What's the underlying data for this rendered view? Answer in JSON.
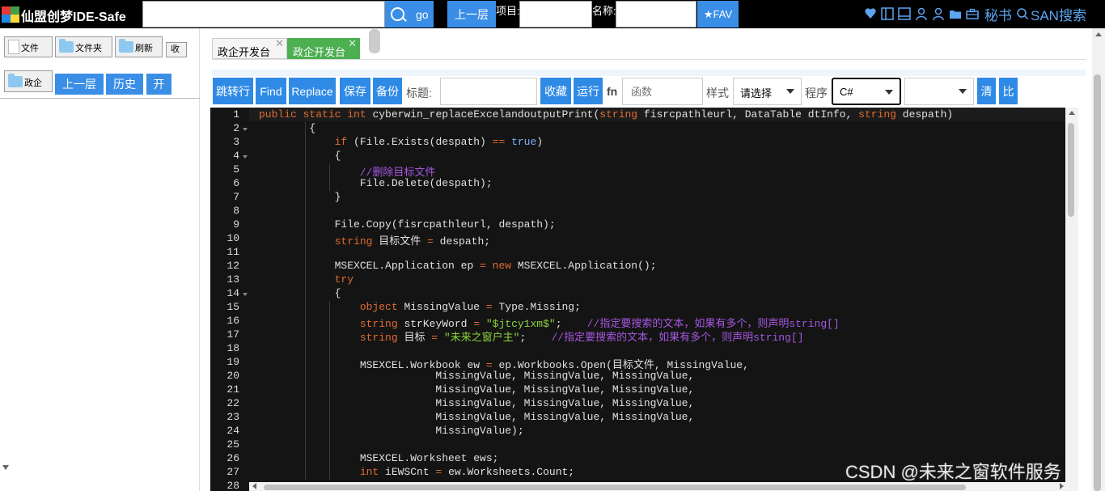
{
  "topbar": {
    "app_title": "仙盟创梦IDE-Safe",
    "search_value": "",
    "go_label": "go",
    "up_label": "上一层",
    "project_label": "项目:",
    "project_value": "",
    "name_label": "名称:",
    "name_value": "",
    "fav_label": "★FAV",
    "secretary_label": "秘书",
    "san_search_label": "SAN搜索"
  },
  "left_panel": {
    "file_button": "文件",
    "folder_button": "文件夹",
    "refresh_button": "刷新",
    "collapse_button": "收",
    "current_folder": "政企",
    "up_button": "上一层",
    "history_button": "历史",
    "open_button": "开"
  },
  "tabs": [
    {
      "label": "政企开发台",
      "active": false
    },
    {
      "label": "政企开发台",
      "active": true
    }
  ],
  "tab_close_glyph": "✕",
  "toolbar": {
    "goto_line": "跳转行",
    "find": "Find",
    "replace": "Replace",
    "save": "保存",
    "backup": "备份",
    "title_label": "标题:",
    "title_value": "",
    "collect": "收藏",
    "run": "运行",
    "fn_label": "fn",
    "function_placeholder": "函数",
    "style_label": "样式",
    "style_select": "请选择",
    "program_label": "程序",
    "language_select": "C#",
    "extra_select": "",
    "clear": "清",
    "compare": "比"
  },
  "colors": {
    "accent_blue": "#2f8ae5",
    "editor_bg": "#141414",
    "keyword": "#e06c32",
    "comment": "#a657e0",
    "string": "#8bd73c",
    "bool": "#7ab0f5"
  },
  "editor": {
    "line_numbers": [
      "1",
      "2",
      "3",
      "4",
      "5",
      "6",
      "7",
      "8",
      "9",
      "10",
      "11",
      "12",
      "13",
      "14",
      "15",
      "16",
      "17",
      "18",
      "19",
      "20",
      "21",
      "22",
      "23",
      "24",
      "25",
      "26",
      "27",
      "28"
    ],
    "folded_lines": [
      2,
      4,
      14
    ],
    "lines": [
      [
        [
          "kw",
          "public static int "
        ],
        [
          "",
          "cyberwin_replaceExcelandoutputPrint("
        ],
        [
          "kw",
          "string "
        ],
        [
          "",
          "fisrcpathleurl, DataTable dtInfo, "
        ],
        [
          "kw",
          "string "
        ],
        [
          "",
          "despath)"
        ]
      ],
      [
        [
          "",
          "        {"
        ]
      ],
      [
        [
          "",
          "            "
        ],
        [
          "kw",
          "if "
        ],
        [
          "",
          "(File.Exists(despath) "
        ],
        [
          "op",
          "== "
        ],
        [
          "tr",
          "true"
        ],
        [
          "",
          ")"
        ]
      ],
      [
        [
          "",
          "            {"
        ]
      ],
      [
        [
          "",
          "                "
        ],
        [
          "cm",
          "//删除目标文件"
        ]
      ],
      [
        [
          "",
          "                File.Delete(despath);"
        ]
      ],
      [
        [
          "",
          "            }"
        ]
      ],
      [
        [
          "",
          ""
        ]
      ],
      [
        [
          "",
          "            File.Copy(fisrcpathleurl, despath);"
        ]
      ],
      [
        [
          "",
          "            "
        ],
        [
          "kw",
          "string "
        ],
        [
          "",
          "目标文件 "
        ],
        [
          "op",
          "= "
        ],
        [
          "",
          "despath;"
        ]
      ],
      [
        [
          "",
          ""
        ]
      ],
      [
        [
          "",
          "            MSEXCEL.Application ep "
        ],
        [
          "op",
          "= "
        ],
        [
          "kw",
          "new "
        ],
        [
          "",
          "MSEXCEL.Application();"
        ]
      ],
      [
        [
          "",
          "            "
        ],
        [
          "kw",
          "try"
        ]
      ],
      [
        [
          "",
          "            {"
        ]
      ],
      [
        [
          "",
          "                "
        ],
        [
          "kw",
          "object "
        ],
        [
          "",
          "MissingValue "
        ],
        [
          "op",
          "= "
        ],
        [
          "",
          "Type.Missing;"
        ]
      ],
      [
        [
          "",
          "                "
        ],
        [
          "kw",
          "string "
        ],
        [
          "",
          "strKeyWord "
        ],
        [
          "op",
          "= "
        ],
        [
          "st",
          "\"$jtcy1xm$\""
        ],
        [
          "",
          ";    "
        ],
        [
          "cm",
          "//指定要搜索的文本，如果有多个，则声明string[]"
        ]
      ],
      [
        [
          "",
          "                "
        ],
        [
          "kw",
          "string "
        ],
        [
          "",
          "目标 "
        ],
        [
          "op",
          "= "
        ],
        [
          "st",
          "\"未来之窗户主\""
        ],
        [
          "",
          ";    "
        ],
        [
          "cm",
          "//指定要搜索的文本，如果有多个，则声明string[]"
        ]
      ],
      [
        [
          "",
          ""
        ]
      ],
      [
        [
          "",
          "                MSEXCEL.Workbook ew "
        ],
        [
          "op",
          "= "
        ],
        [
          "",
          "ep.Workbooks.Open(目标文件, MissingValue,"
        ]
      ],
      [
        [
          "",
          "                            MissingValue, MissingValue, MissingValue,"
        ]
      ],
      [
        [
          "",
          "                            MissingValue, MissingValue, MissingValue,"
        ]
      ],
      [
        [
          "",
          "                            MissingValue, MissingValue, MissingValue,"
        ]
      ],
      [
        [
          "",
          "                            MissingValue, MissingValue, MissingValue,"
        ]
      ],
      [
        [
          "",
          "                            MissingValue);"
        ]
      ],
      [
        [
          "",
          ""
        ]
      ],
      [
        [
          "",
          "                MSEXCEL.Worksheet ews;"
        ]
      ],
      [
        [
          "",
          "                "
        ],
        [
          "kw",
          "int "
        ],
        [
          "",
          "iEWSCnt "
        ],
        [
          "op",
          "= "
        ],
        [
          "",
          "ew.Worksheets.Count;"
        ]
      ],
      [
        [
          "",
          ""
        ]
      ]
    ]
  },
  "watermark": "CSDN @未来之窗软件服务"
}
